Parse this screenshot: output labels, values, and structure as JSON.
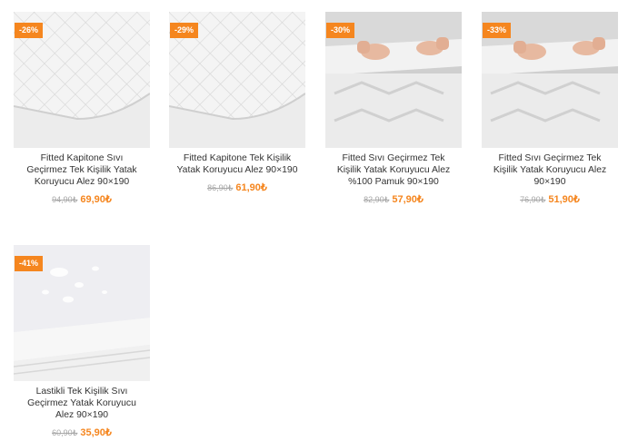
{
  "products": [
    {
      "discount": "-26%",
      "title": "Fitted Kapitone Sıvı Geçirmez Tek Kişilik Yatak Koruyucu Alez 90×190",
      "old_price": "94,90₺",
      "new_price": "69,90₺",
      "image": "quilted-mattress-protector"
    },
    {
      "discount": "-29%",
      "title": "Fitted Kapitone Tek Kişilik Yatak Koruyucu Alez 90×190",
      "old_price": "86,90₺",
      "new_price": "61,90₺",
      "image": "quilted-mattress-protector"
    },
    {
      "discount": "-30%",
      "title": "Fitted Sıvı Geçirmez Tek Kişilik Yatak Koruyucu Alez %100 Pamuk 90×190",
      "old_price": "82,90₺",
      "new_price": "57,90₺",
      "image": "hands-fitting-protector"
    },
    {
      "discount": "-33%",
      "title": "Fitted Sıvı Geçirmez Tek Kişilik Yatak Koruyucu Alez 90×190",
      "old_price": "76,90₺",
      "new_price": "51,90₺",
      "image": "hands-fitting-protector"
    },
    {
      "discount": "-41%",
      "title": "Lastikli Tek Kişilik Sıvı Geçirmez Yatak Koruyucu Alez 90×190",
      "old_price": "60,90₺",
      "new_price": "35,90₺",
      "image": "waterproof-droplets-protector"
    }
  ],
  "colors": {
    "accent": "#f5861f",
    "old_price": "#a7a7a7",
    "text": "#333333"
  }
}
